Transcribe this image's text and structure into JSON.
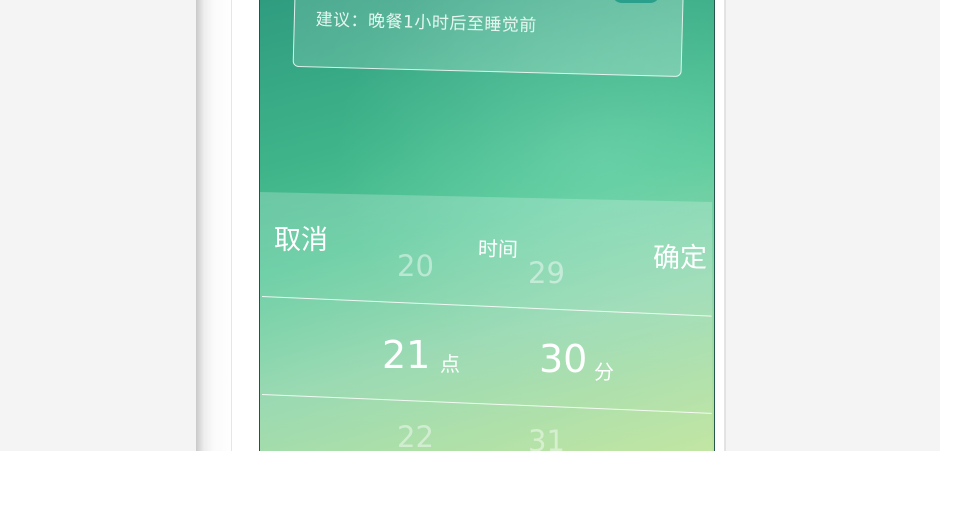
{
  "suggestion": {
    "text": "建议：晚餐1小时后至睡觉前"
  },
  "picker": {
    "cancel_label": "取消",
    "title": "时间",
    "confirm_label": "确定",
    "hour": {
      "prev": "20",
      "selected": "21",
      "next": "22",
      "unit": "点"
    },
    "minute": {
      "prev": "29",
      "selected": "30",
      "next": "31",
      "unit": "分"
    }
  }
}
